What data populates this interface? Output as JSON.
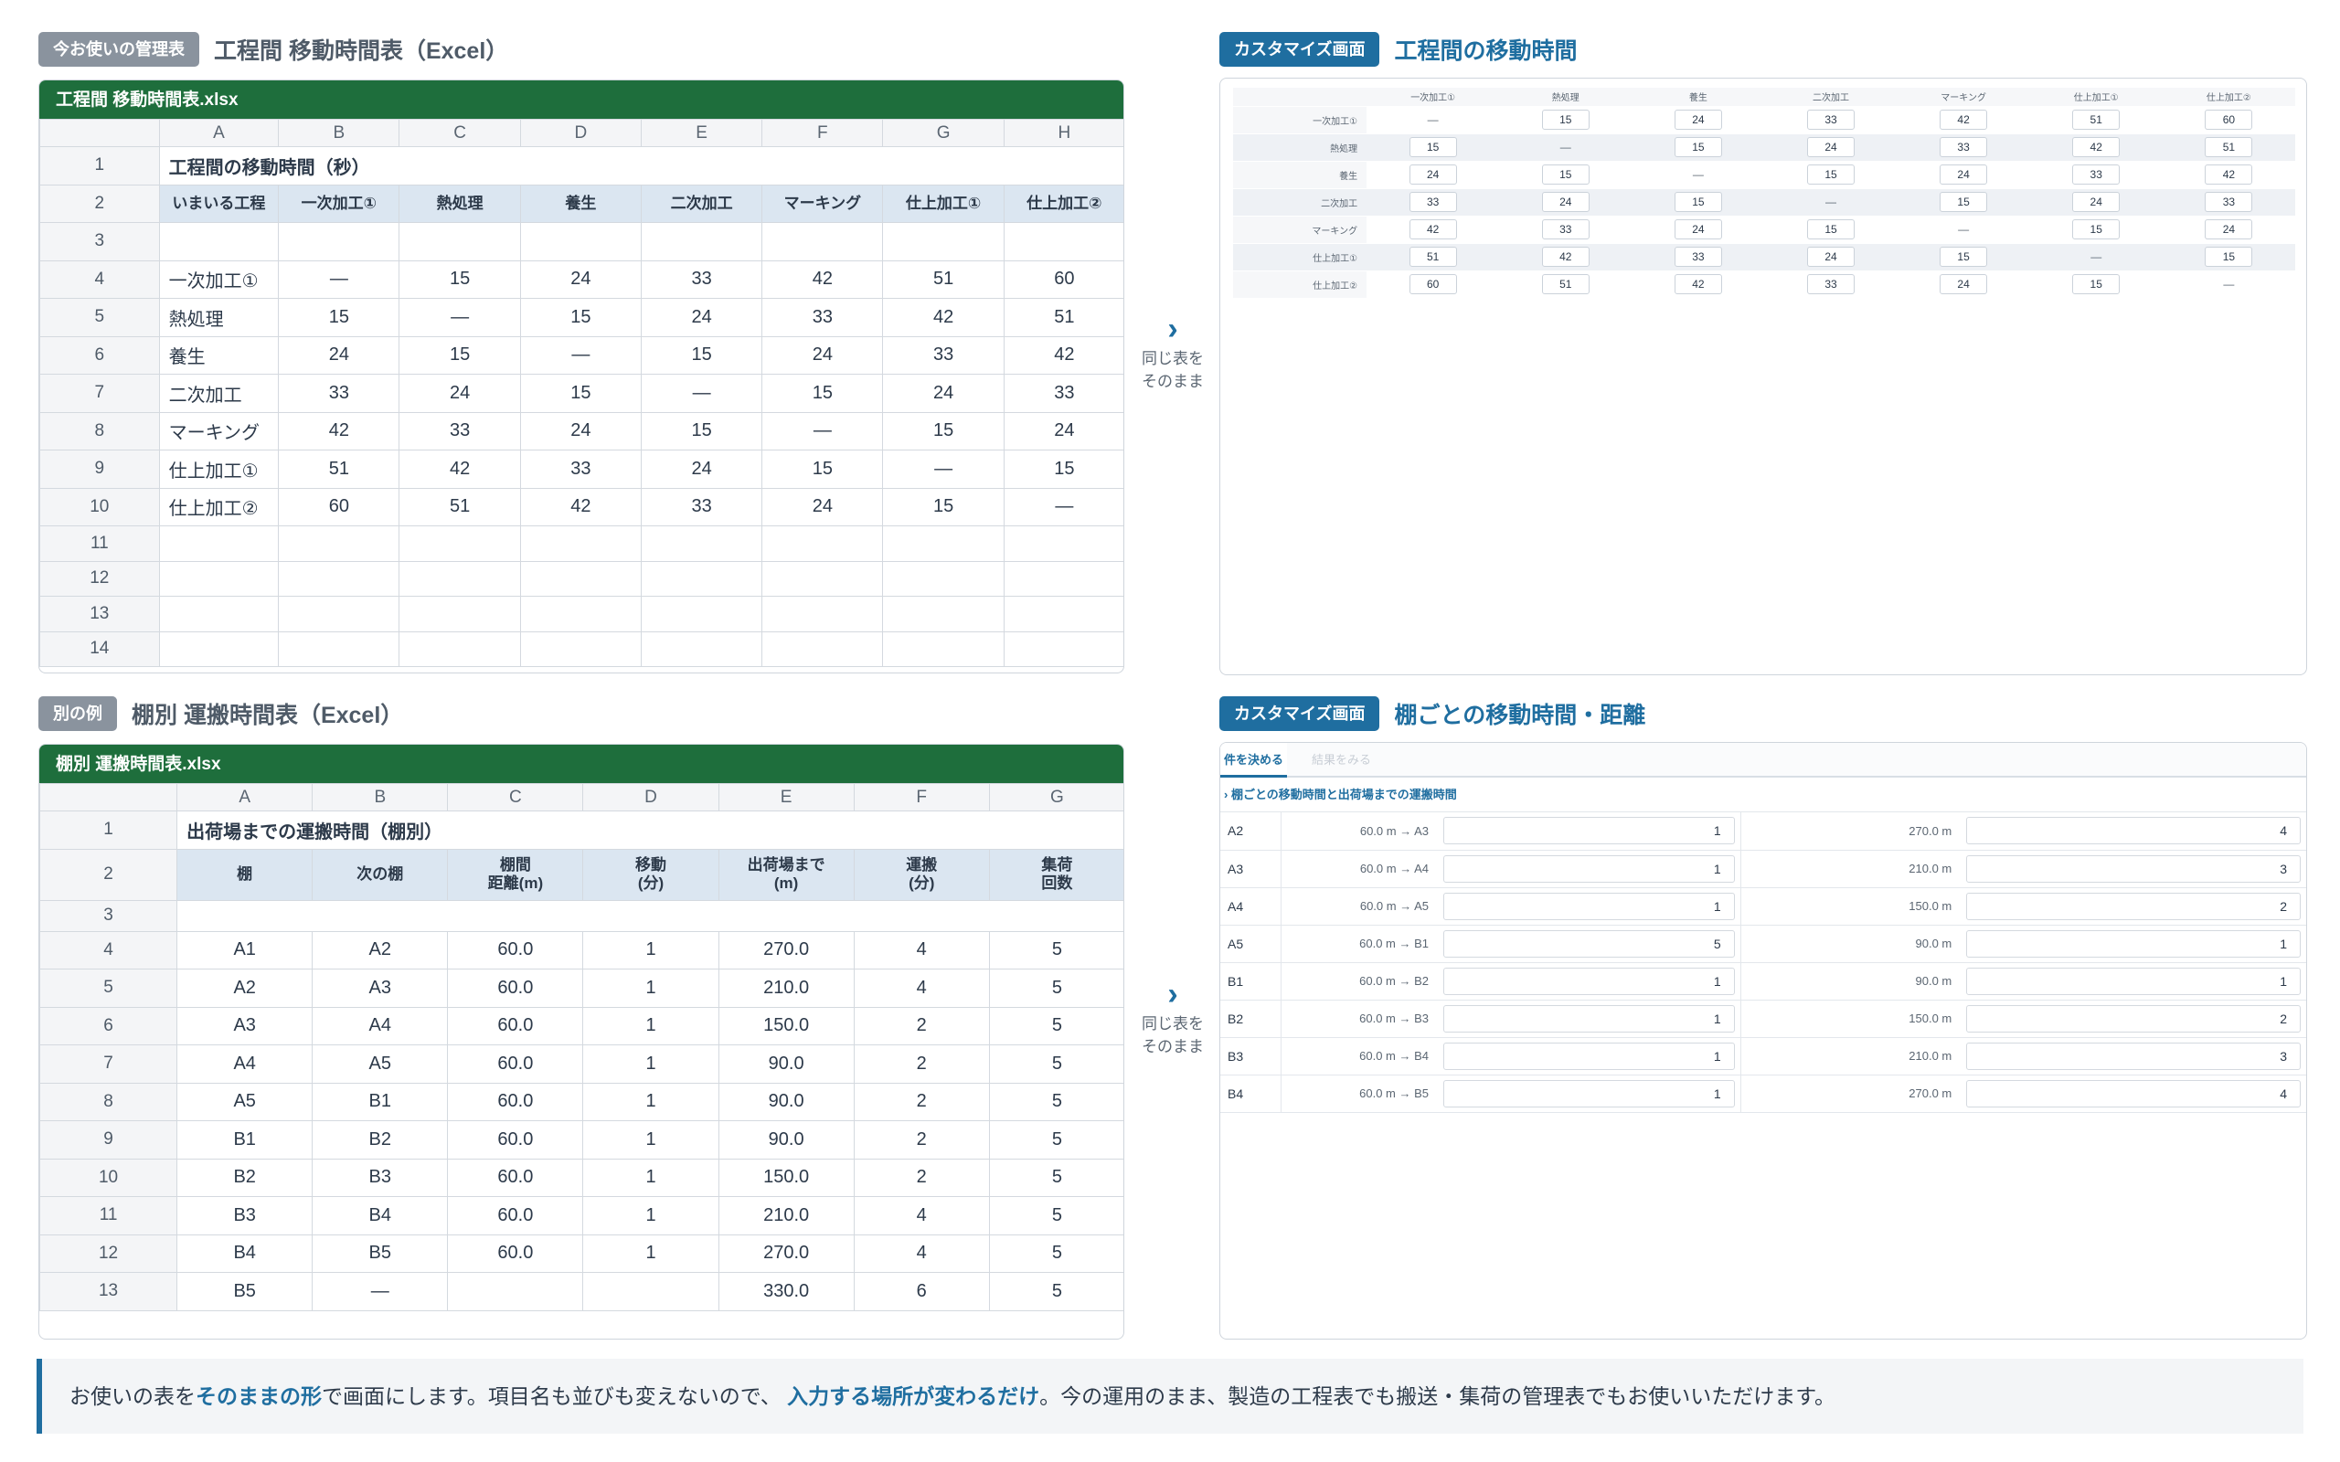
{
  "top_left": {
    "tag": "今お使いの管理表",
    "title": "工程間 移動時間表（Excel）",
    "file": "工程間 移動時間表.xlsx",
    "cols": [
      "A",
      "B",
      "C",
      "D",
      "E",
      "F",
      "G",
      "H"
    ],
    "row_numbers": [
      "1",
      "2",
      "3",
      "4",
      "5",
      "6",
      "7",
      "8",
      "9",
      "10",
      "11",
      "12",
      "13",
      "14"
    ],
    "sheet_title": "工程間の移動時間（秒）",
    "headers": [
      "いまいる工程",
      "一次加工①",
      "熱処理",
      "養生",
      "二次加工",
      "マーキング",
      "仕上加工①",
      "仕上加工②"
    ],
    "rows": [
      [
        "一次加工①",
        "—",
        "15",
        "24",
        "33",
        "42",
        "51",
        "60"
      ],
      [
        "熱処理",
        "15",
        "—",
        "15",
        "24",
        "33",
        "42",
        "51"
      ],
      [
        "養生",
        "24",
        "15",
        "—",
        "15",
        "24",
        "33",
        "42"
      ],
      [
        "二次加工",
        "33",
        "24",
        "15",
        "—",
        "15",
        "24",
        "33"
      ],
      [
        "マーキング",
        "42",
        "33",
        "24",
        "15",
        "—",
        "15",
        "24"
      ],
      [
        "仕上加工①",
        "51",
        "42",
        "33",
        "24",
        "15",
        "—",
        "15"
      ],
      [
        "仕上加工②",
        "60",
        "51",
        "42",
        "33",
        "24",
        "15",
        "—"
      ]
    ]
  },
  "top_right": {
    "tag": "カスタマイズ画面",
    "title": "工程間の移動時間",
    "col_headers": [
      "一次加工①",
      "熱処理",
      "養生",
      "二次加工",
      "マーキング",
      "仕上加工①",
      "仕上加工②"
    ],
    "row_labels": [
      "一次加工①",
      "熱処理",
      "養生",
      "二次加工",
      "マーキング",
      "仕上加工①",
      "仕上加工②"
    ]
  },
  "bottom_left": {
    "tag": "別の例",
    "title": "棚別 運搬時間表（Excel）",
    "file": "棚別 運搬時間表.xlsx",
    "cols": [
      "A",
      "B",
      "C",
      "D",
      "E",
      "F",
      "G"
    ],
    "row_numbers": [
      "1",
      "2",
      "3",
      "4",
      "5",
      "6",
      "7",
      "8",
      "9",
      "10",
      "11",
      "12",
      "13"
    ],
    "sheet_title": "出荷場までの運搬時間（棚別）",
    "headers": [
      "棚",
      "次の棚",
      "棚間\n距離(m)",
      "移動\n(分)",
      "出荷場まで\n(m)",
      "運搬\n(分)",
      "集荷\n回数"
    ],
    "rows": [
      [
        "A1",
        "A2",
        "60.0",
        "1",
        "270.0",
        "4",
        "5"
      ],
      [
        "A2",
        "A3",
        "60.0",
        "1",
        "210.0",
        "4",
        "5"
      ],
      [
        "A3",
        "A4",
        "60.0",
        "1",
        "150.0",
        "2",
        "5"
      ],
      [
        "A4",
        "A5",
        "60.0",
        "1",
        "90.0",
        "2",
        "5"
      ],
      [
        "A5",
        "B1",
        "60.0",
        "1",
        "90.0",
        "2",
        "5"
      ],
      [
        "B1",
        "B2",
        "60.0",
        "1",
        "90.0",
        "2",
        "5"
      ],
      [
        "B2",
        "B3",
        "60.0",
        "1",
        "150.0",
        "2",
        "5"
      ],
      [
        "B3",
        "B4",
        "60.0",
        "1",
        "210.0",
        "4",
        "5"
      ],
      [
        "B4",
        "B5",
        "60.0",
        "1",
        "270.0",
        "4",
        "5"
      ],
      [
        "B5",
        "—",
        "",
        "",
        "330.0",
        "6",
        "5"
      ]
    ]
  },
  "bottom_right": {
    "tag": "カスタマイズ画面",
    "title": "棚ごとの移動時間・距離",
    "tab_active": "件を決める",
    "tab_inactive": "結果をみる",
    "section": "› 棚ごとの移動時間と出荷場までの運搬時間",
    "rows": [
      {
        "name": "A2",
        "dist": "60.0 m → A3",
        "move": "1",
        "ship": "270.0 m",
        "carry": "4"
      },
      {
        "name": "A3",
        "dist": "60.0 m → A4",
        "move": "1",
        "ship": "210.0 m",
        "carry": "3"
      },
      {
        "name": "A4",
        "dist": "60.0 m → A5",
        "move": "1",
        "ship": "150.0 m",
        "carry": "2"
      },
      {
        "name": "A5",
        "dist": "60.0 m → B1",
        "move": "5",
        "ship": "90.0 m",
        "carry": "1"
      },
      {
        "name": "B1",
        "dist": "60.0 m → B2",
        "move": "1",
        "ship": "90.0 m",
        "carry": "1"
      },
      {
        "name": "B2",
        "dist": "60.0 m → B3",
        "move": "1",
        "ship": "150.0 m",
        "carry": "2"
      },
      {
        "name": "B3",
        "dist": "60.0 m → B4",
        "move": "1",
        "ship": "210.0 m",
        "carry": "3"
      },
      {
        "name": "B4",
        "dist": "60.0 m → B5",
        "move": "1",
        "ship": "270.0 m",
        "carry": "4"
      }
    ]
  },
  "arrow": {
    "line1": "同じ表を",
    "line2": "そのまま"
  },
  "footer": {
    "p1": "お使いの表を",
    "em1": "そのままの形",
    "p2": "で画面にします。項目名も並びも変えないので、",
    "em2": "入力する場所が変わるだけ",
    "p3": "。今の運用のまま、製造の工程表でも搬送・集荷の管理表でもお使いいただけます。"
  },
  "colors": {
    "excel_green": "#1e6e3c",
    "accent_blue": "#1f6ea0",
    "header_fill": "#dbe6f1",
    "tag_gray": "#8a939e"
  }
}
